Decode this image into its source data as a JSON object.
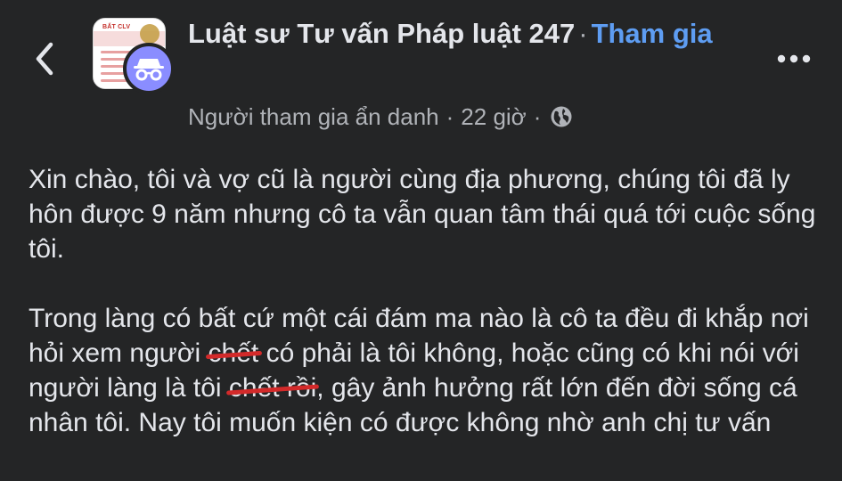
{
  "header": {
    "back_icon": "chevron-left-icon",
    "group_name": "Luật sư Tư vấn Pháp luật 247",
    "separator": "·",
    "join_label": "Tham gia",
    "more_icon": "more-horizontal-icon",
    "avatar_label": "BẤT CLV"
  },
  "meta": {
    "author": "Người tham gia ẩn danh",
    "separator": "·",
    "time": "22 giờ",
    "separator2": "·",
    "privacy_icon": "globe-icon"
  },
  "post": {
    "para1": "Xin chào, tôi và vợ cũ là người cùng địa phương, chúng tôi đã ly hôn được 9 năm nhưng cô ta vẫn quan tâm thái quá tới cuộc sống tôi.",
    "para2_a": "Trong làng có bất cứ một cái đám ma nào là cô ta đều đi khắp nơi hỏi xem người ",
    "para2_strike1": "chết",
    "para2_b": " có phải là tôi không, hoặc cũng có khi nói với người làng là tôi ",
    "para2_strike2": "chết rồi",
    "para2_c": ", gây ảnh hưởng rất lớn đến đời sống cá nhân tôi. Nay tôi muốn kiện có được không nhờ anh chị tư vấn"
  },
  "colors": {
    "background": "#242526",
    "text": "#e4e6eb",
    "secondary_text": "#b0b3b8",
    "link": "#5e9df2",
    "anon_badge": "#8a8dff",
    "strike": "#d32a2a"
  }
}
